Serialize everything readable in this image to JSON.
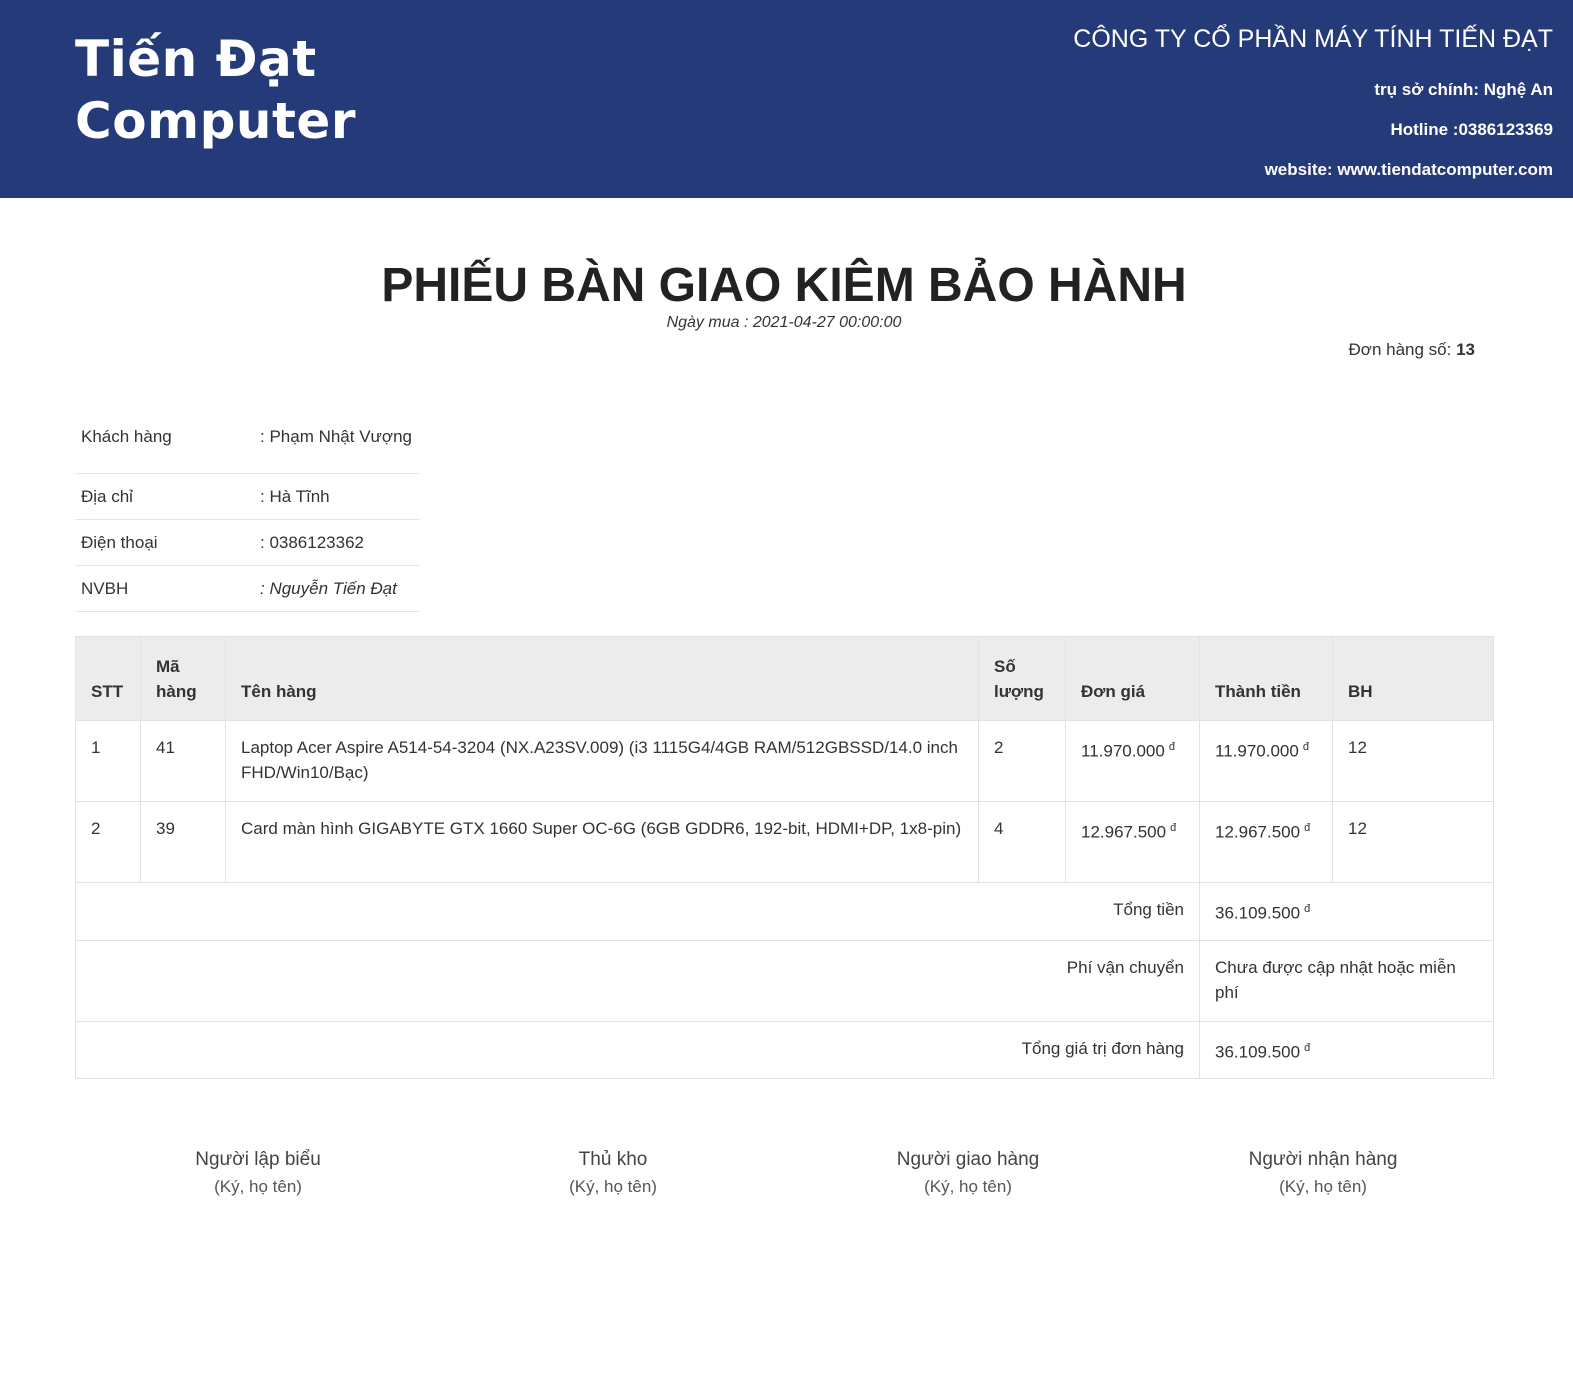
{
  "header": {
    "logo_line1": "Tiến Đạt",
    "logo_line2": "Computer",
    "company_name": "CÔNG TY CỔ PHẦN MÁY TÍNH TIẾN ĐẠT",
    "hq": "trụ sở chính: Nghệ An",
    "hotline": "Hotline :0386123369",
    "website": "website: www.tiendatcomputer.com"
  },
  "doc": {
    "title": "PHIẾU BÀN GIAO KIÊM BẢO HÀNH",
    "date": "Ngày mua : 2021-04-27 00:00:00",
    "order_label": "Đơn hàng số: ",
    "order_number": "13"
  },
  "customer": [
    {
      "label": "Khách hàng",
      "value": ": Phạm Nhật Vượng"
    },
    {
      "label": "Địa chỉ",
      "value": ": Hà Tĩnh"
    },
    {
      "label": "Điện thoại",
      "value": ": 0386123362"
    },
    {
      "label": "NVBH",
      "value": ": Nguyễn Tiến Đạt"
    }
  ],
  "table": {
    "headers": [
      "STT",
      "Mã hàng",
      "Tên hàng",
      "Số lượng",
      "Đơn giá",
      "Thành tiền",
      "BH"
    ],
    "currency": "đ",
    "rows": [
      {
        "stt": "1",
        "code": "41",
        "name": "Laptop Acer Aspire A514-54-3204 (NX.A23SV.009) (i3 1115G4/4GB RAM/512GBSSD/14.0 inch FHD/Win10/Bạc)",
        "qty": "2",
        "price": "11.970.000",
        "total": "11.970.000",
        "warranty": "12"
      },
      {
        "stt": "2",
        "code": "39",
        "name": "Card màn hình GIGABYTE GTX 1660 Super OC-6G (6GB GDDR6, 192-bit, HDMI+DP, 1x8-pin)",
        "qty": "4",
        "price": "12.967.500",
        "total": "12.967.500",
        "warranty": "12"
      }
    ],
    "summary": {
      "subtotal_label": "Tổng tiền",
      "subtotal_value": "36.109.500",
      "shipping_label": "Phí vận chuyển",
      "shipping_value": "Chưa được cập nhật hoặc miễn phí",
      "grand_label": "Tổng giá trị đơn hàng",
      "grand_value": "36.109.500"
    }
  },
  "signatures": [
    {
      "role": "Người lập biểu",
      "note": "(Ký, họ tên)"
    },
    {
      "role": "Thủ kho",
      "note": "(Ký, họ tên)"
    },
    {
      "role": "Người giao hàng",
      "note": "(Ký, họ tên)"
    },
    {
      "role": "Người nhận hàng",
      "note": "(Ký, họ tên)"
    }
  ]
}
